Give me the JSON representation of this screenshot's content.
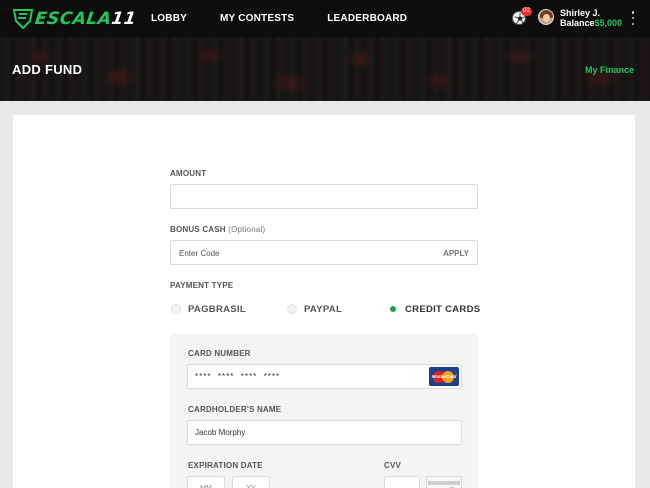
{
  "header": {
    "logo_text": "ESCALA",
    "logo_num": "11",
    "nav": [
      "LOBBY",
      "MY CONTESTS",
      "LEADERBOARD"
    ],
    "notifications_count": "02",
    "user_name": "Shirley J.",
    "balance_label": "Balance",
    "balance_value": "$5,000"
  },
  "hero": {
    "title": "ADD FUND",
    "link": "My Finance"
  },
  "form": {
    "amount_label": "AMOUNT",
    "amount_value": "",
    "bonus_label": "BONUS CASH",
    "bonus_optional": "(Optional)",
    "code_placeholder": "Enter Code",
    "apply_label": "APPLY",
    "payment_type_label": "PAYMENT TYPE",
    "payment_options": [
      {
        "label": "PAGBRASIL",
        "selected": false
      },
      {
        "label": "PAYPAL",
        "selected": false
      },
      {
        "label": "CREDIT CARDS",
        "selected": true
      }
    ],
    "card_number_label": "CARD NUMBER",
    "card_number_value": "****  ****  ****  ****",
    "card_brand_icon": "mastercard-icon",
    "card_brand_text": "MasterCard",
    "cardholder_label": "CARDHOLDER'S NAME",
    "cardholder_value": "Jacob Morphy",
    "expiration_label": "EXPIRATION DATE",
    "month_placeholder": "MM",
    "year_placeholder": "YY",
    "cvv_label": "CVV"
  },
  "colors": {
    "accent": "#22c55e",
    "selected_radio": "#16a34a",
    "badge": "#e5332a"
  }
}
